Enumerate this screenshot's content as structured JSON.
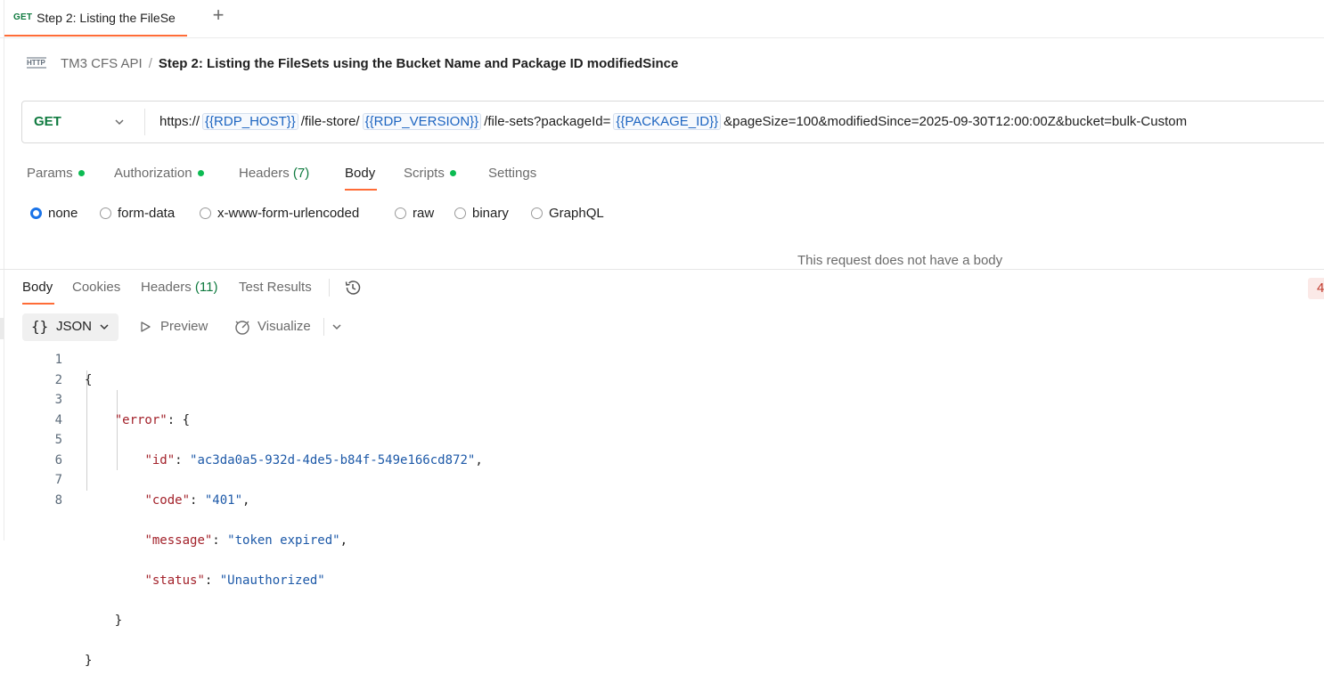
{
  "tabbar": {
    "active_tab": {
      "method": "GET",
      "title": "Step 2: Listing the FileSe"
    },
    "new_tab_symbol": "+"
  },
  "breadcrumb": {
    "icon": "http-icon",
    "collection": "TM3 CFS API",
    "separator": "/",
    "title": "Step 2: Listing the FileSets using the Bucket Name and Package ID modifiedSince"
  },
  "request": {
    "method": "GET",
    "url_parts": [
      {
        "type": "text",
        "value": "https://"
      },
      {
        "type": "var",
        "value": "{{RDP_HOST}}"
      },
      {
        "type": "text",
        "value": "/file-store/"
      },
      {
        "type": "var",
        "value": "{{RDP_VERSION}}"
      },
      {
        "type": "text",
        "value": "/file-sets?packageId="
      },
      {
        "type": "var",
        "value": "{{PACKAGE_ID}}"
      },
      {
        "type": "text",
        "value": "&pageSize=100&modifiedSince=2025-09-30T12:00:00Z&bucket=bulk-Custom"
      }
    ]
  },
  "request_tabs": {
    "params": "Params",
    "authorization": "Authorization",
    "headers": "Headers",
    "headers_count": "(7)",
    "body": "Body",
    "scripts": "Scripts",
    "settings": "Settings",
    "active": "Body"
  },
  "body_types": {
    "none": "none",
    "form_data": "form-data",
    "urlencoded": "x-www-form-urlencoded",
    "raw": "raw",
    "binary": "binary",
    "graphql": "GraphQL",
    "selected": "none"
  },
  "no_body_message": "This request does not have a body",
  "response_tabs": {
    "body": "Body",
    "cookies": "Cookies",
    "headers": "Headers",
    "headers_count": "(11)",
    "test_results": "Test Results",
    "active": "Body"
  },
  "response_status_partial": "4",
  "response_toolbar": {
    "format_braces": "{}",
    "format": "JSON",
    "preview": "Preview",
    "visualize": "Visualize"
  },
  "response_body": {
    "line_numbers": [
      "1",
      "2",
      "3",
      "4",
      "5",
      "6",
      "7",
      "8"
    ],
    "open_brace": "{",
    "error_key": "\"error\"",
    "fields": [
      {
        "key": "\"id\"",
        "value": "\"ac3da0a5-932d-4de5-b84f-549e166cd872\"",
        "trail": ","
      },
      {
        "key": "\"code\"",
        "value": "\"401\"",
        "trail": ","
      },
      {
        "key": "\"message\"",
        "value": "\"token expired\"",
        "trail": ","
      },
      {
        "key": "\"status\"",
        "value": "\"Unauthorized\"",
        "trail": ""
      }
    ],
    "close_inner": "}",
    "close_outer": "}"
  },
  "colors": {
    "accent": "#ff6c37",
    "get_method": "#0f7a3f",
    "variable": "#1d65c1",
    "json_key": "#a3222b",
    "json_string": "#1d59a8",
    "status_dot": "#0cbb52",
    "radio_selected": "#1a73e8"
  }
}
